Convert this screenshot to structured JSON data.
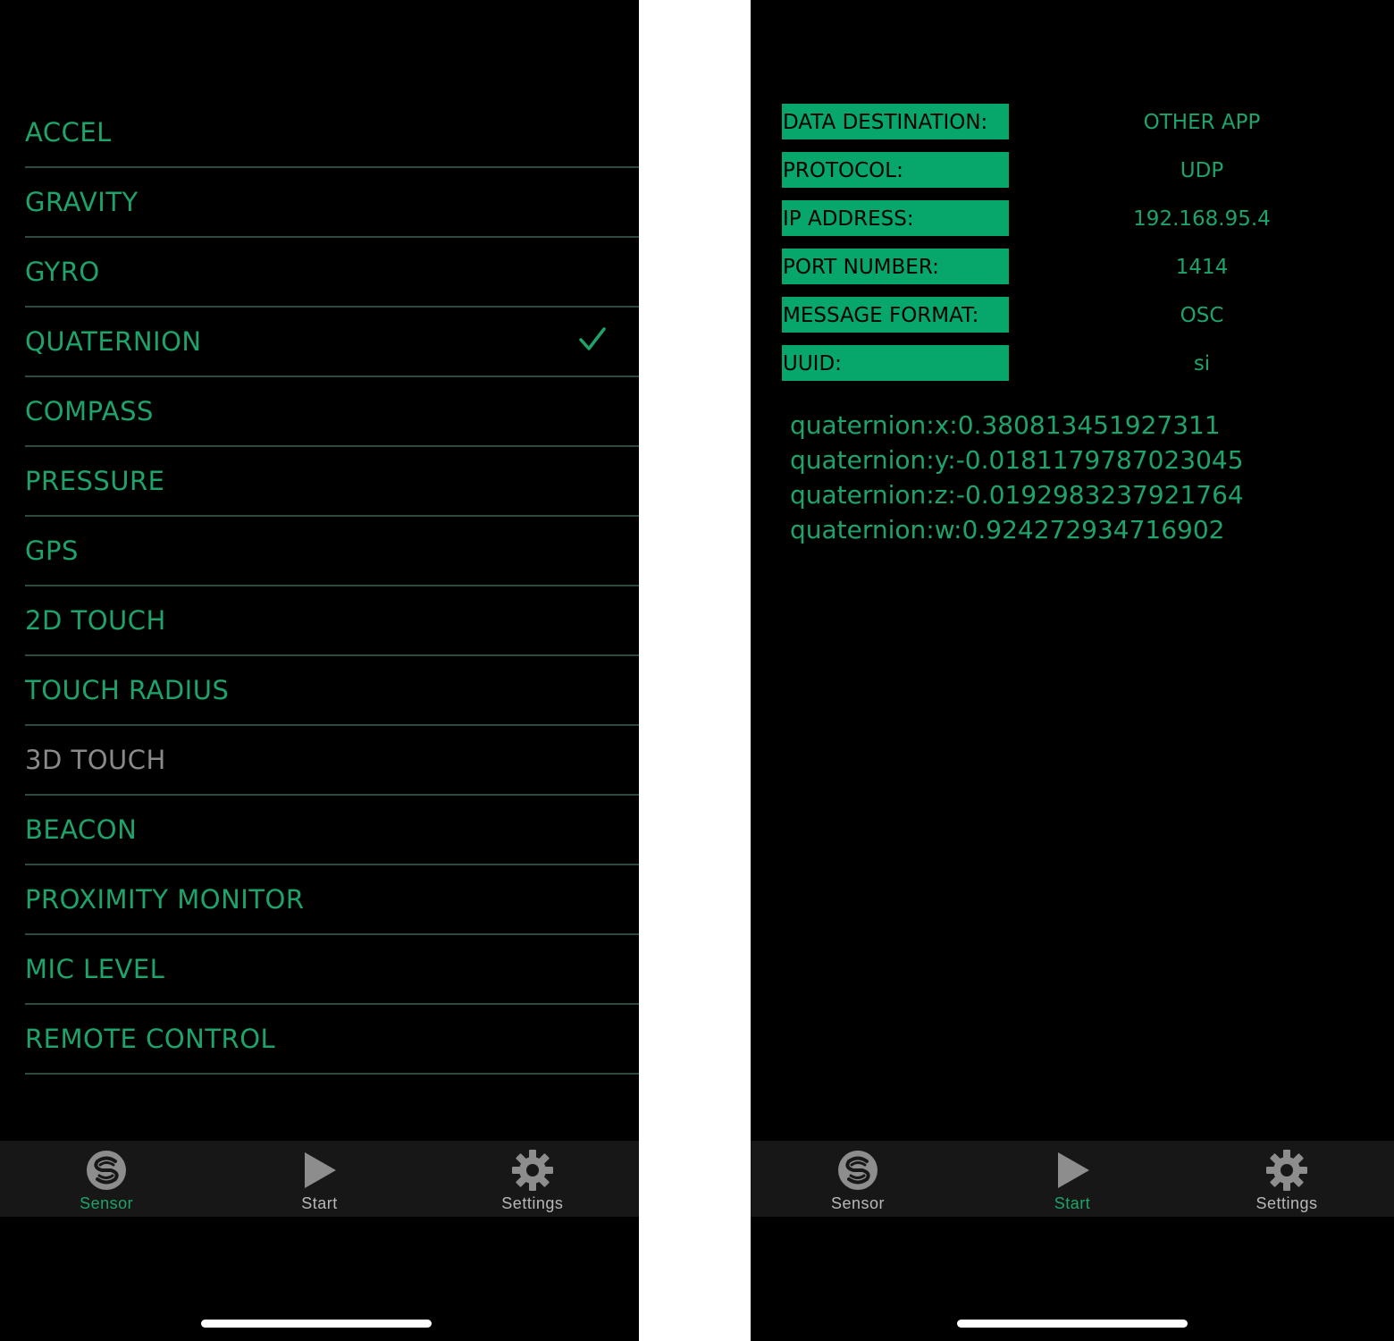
{
  "colors": {
    "accent": "#1ea36a",
    "key_bg": "#07a76c",
    "disabled": "#8a8a8a",
    "tab_bar": "#171717"
  },
  "left": {
    "sensors": [
      {
        "label": "ACCEL",
        "checked": false,
        "enabled": true
      },
      {
        "label": "GRAVITY",
        "checked": false,
        "enabled": true
      },
      {
        "label": "GYRO",
        "checked": false,
        "enabled": true
      },
      {
        "label": "QUATERNION",
        "checked": true,
        "enabled": true
      },
      {
        "label": "COMPASS",
        "checked": false,
        "enabled": true
      },
      {
        "label": "PRESSURE",
        "checked": false,
        "enabled": true
      },
      {
        "label": "GPS",
        "checked": false,
        "enabled": true
      },
      {
        "label": "2D TOUCH",
        "checked": false,
        "enabled": true
      },
      {
        "label": "TOUCH RADIUS",
        "checked": false,
        "enabled": true
      },
      {
        "label": "3D TOUCH",
        "checked": false,
        "enabled": false
      },
      {
        "label": "BEACON",
        "checked": false,
        "enabled": true
      },
      {
        "label": "PROXIMITY MONITOR",
        "checked": false,
        "enabled": true
      },
      {
        "label": "MIC LEVEL",
        "checked": false,
        "enabled": true
      },
      {
        "label": "REMOTE CONTROL",
        "checked": false,
        "enabled": true
      }
    ],
    "tabs": [
      {
        "label": "Sensor",
        "icon": "sensor-logo-icon",
        "active": true
      },
      {
        "label": "Start",
        "icon": "play-icon",
        "active": false
      },
      {
        "label": "Settings",
        "icon": "gear-icon",
        "active": false
      }
    ]
  },
  "right": {
    "settings": [
      {
        "key": "DATA DESTINATION:",
        "value": "OTHER APP"
      },
      {
        "key": "PROTOCOL:",
        "value": "UDP"
      },
      {
        "key": "IP ADDRESS:",
        "value": "192.168.95.4"
      },
      {
        "key": "PORT NUMBER:",
        "value": "1414"
      },
      {
        "key": "MESSAGE FORMAT:",
        "value": "OSC"
      },
      {
        "key": "UUID:",
        "value": "si"
      }
    ],
    "readout": [
      "quaternion:x:0.380813451927311",
      "quaternion:y:-0.0181179787023045",
      "quaternion:z:-0.0192983237921764",
      "quaternion:w:0.924272934716902"
    ],
    "tabs": [
      {
        "label": "Sensor",
        "icon": "sensor-logo-icon",
        "active": false
      },
      {
        "label": "Start",
        "icon": "play-icon",
        "active": true
      },
      {
        "label": "Settings",
        "icon": "gear-icon",
        "active": false
      }
    ]
  }
}
